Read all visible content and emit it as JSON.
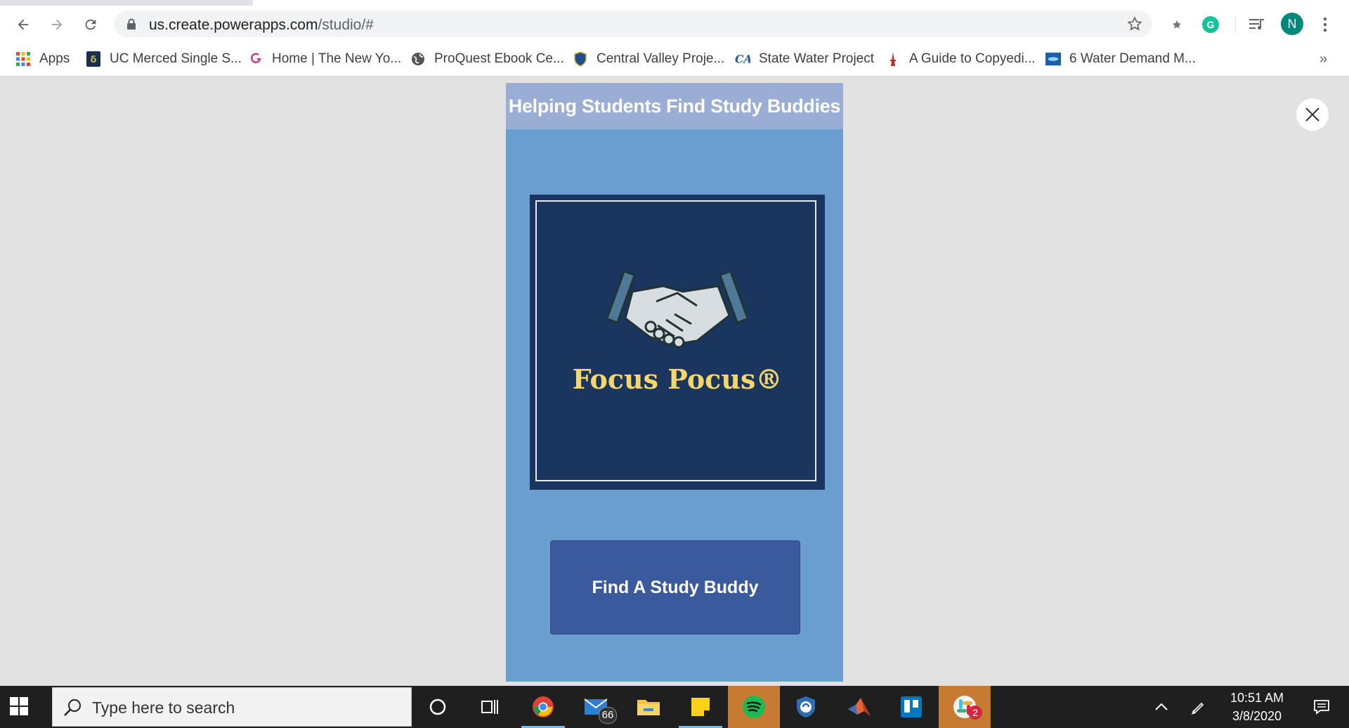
{
  "browser": {
    "url_host": "us.create.powerapps.com",
    "url_path": "/studio/#",
    "profile_initial": "N"
  },
  "bookmarks": [
    {
      "label": "Apps"
    },
    {
      "label": "UC Merced Single S..."
    },
    {
      "label": "Home | The New Yo..."
    },
    {
      "label": "ProQuest Ebook Ce..."
    },
    {
      "label": "Central Valley Proje..."
    },
    {
      "label": "State Water Project"
    },
    {
      "label": "A Guide to Copyedi..."
    },
    {
      "label": "6 Water Demand M..."
    }
  ],
  "bookmarks_more": "»",
  "app": {
    "title": "Helping Students Find Study Buddies",
    "logo_text": "Focus Pocus®",
    "button_label": "Find A Study Buddy"
  },
  "taskbar": {
    "search_placeholder": "Type here to search",
    "mail_badge": "66",
    "slack_badge": "2",
    "time": "10:51 AM",
    "date": "3/8/2020"
  },
  "colors": {
    "app_background": "#6a9ecf",
    "header_background": "#9aaed5",
    "logo_background": "#1b365e",
    "logo_text": "#f5d66b",
    "button_background": "#3b5a9d",
    "avatar": "#00897b"
  }
}
